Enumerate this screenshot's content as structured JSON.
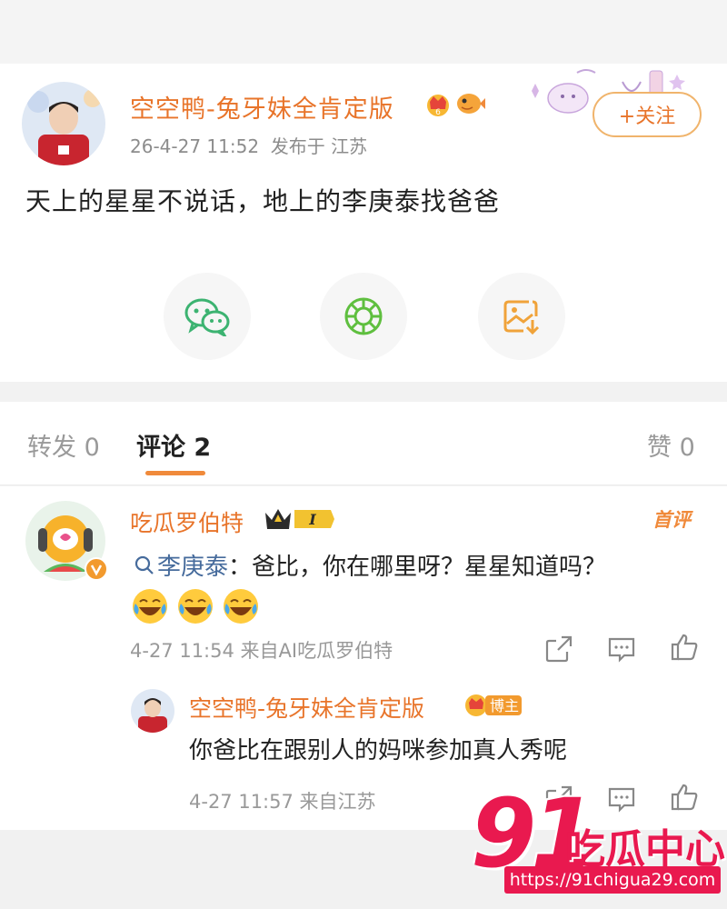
{
  "post": {
    "author": "空空鸭-兔牙妹全肯定版",
    "time": "26-4-27 11:52",
    "location": "发布于 江苏",
    "follow_label": "+关注",
    "text": "天上的星星不说话，地上的李庚泰找爸爸",
    "icons": [
      "wechat-icon",
      "moments-icon",
      "save-image-icon"
    ]
  },
  "tabs": {
    "repost": "转发 0",
    "comments": "评论 2",
    "likes": "赞 0"
  },
  "comment": {
    "author": "吃瓜罗伯特",
    "first_tag": "首评",
    "mention": "李庚泰",
    "text": "：爸比，你在哪里呀？星星知道吗？",
    "emoji_count": 3,
    "meta": "4-27 11:54  来自AI吃瓜罗伯特"
  },
  "reply": {
    "author": "空空鸭-兔牙妹全肯定版",
    "badge": "博主",
    "text": "你爸比在跟别人的妈咪参加真人秀呢",
    "meta": "4-27 11:57  来自江苏"
  },
  "watermark": {
    "number": "91",
    "name": "吃瓜中心",
    "url": "https://91chigua29.com"
  },
  "colors": {
    "accent": "#e8742a",
    "mention": "#466b9c",
    "watermark": "#e9194f"
  }
}
